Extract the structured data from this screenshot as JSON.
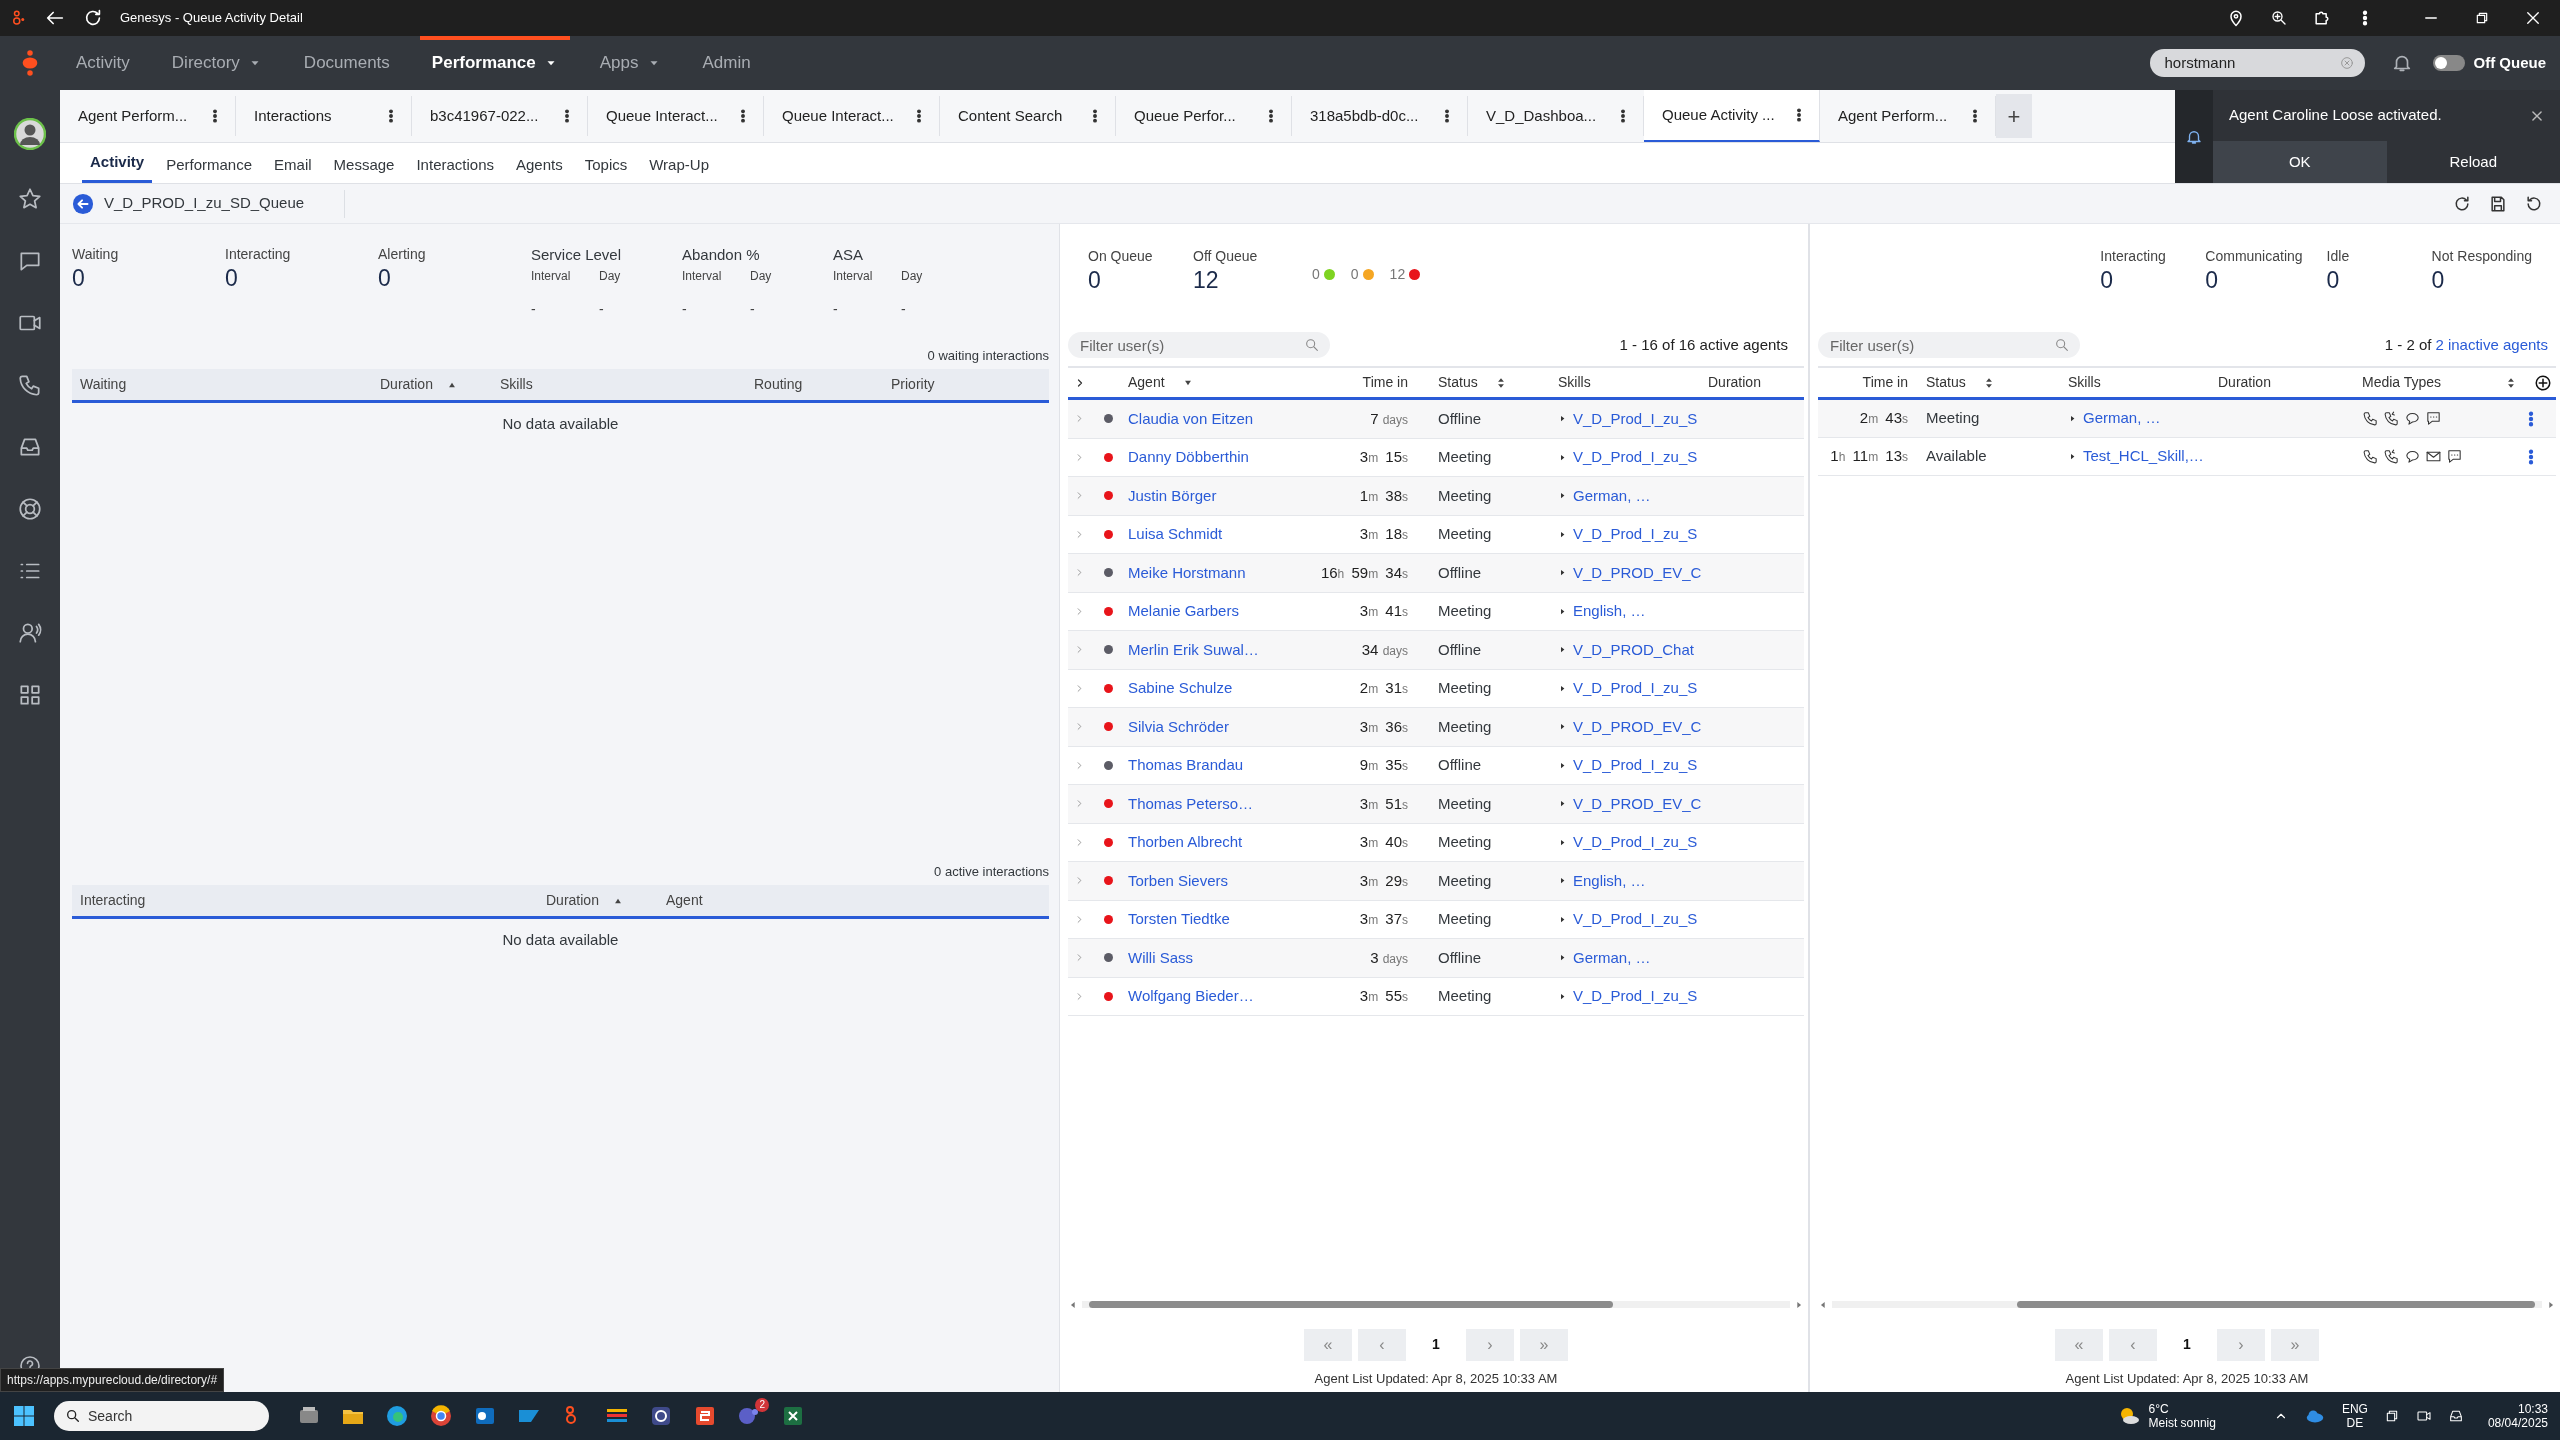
{
  "window": {
    "title": "Genesys - Queue Activity Detail"
  },
  "status_url": "https://apps.mypurecloud.de/directory/#",
  "nav": {
    "items": [
      {
        "label": "Activity",
        "dropdown": false,
        "selected": false
      },
      {
        "label": "Directory",
        "dropdown": true,
        "selected": false
      },
      {
        "label": "Documents",
        "dropdown": false,
        "selected": false
      },
      {
        "label": "Performance",
        "dropdown": true,
        "selected": true
      },
      {
        "label": "Apps",
        "dropdown": true,
        "selected": false
      },
      {
        "label": "Admin",
        "dropdown": false,
        "selected": false
      }
    ],
    "search": {
      "value": "horstmann"
    },
    "queue_toggle": {
      "label": "Off Queue",
      "on": false
    }
  },
  "tabs": [
    {
      "label": "Agent Perform...",
      "selected": false
    },
    {
      "label": "Interactions",
      "selected": false
    },
    {
      "label": "b3c41967-022...",
      "selected": false
    },
    {
      "label": "Queue Interact...",
      "selected": false
    },
    {
      "label": "Queue Interact...",
      "selected": false
    },
    {
      "label": "Content Search",
      "selected": false
    },
    {
      "label": "Queue Perfor...",
      "selected": false
    },
    {
      "label": "318a5bdb-d0c...",
      "selected": false
    },
    {
      "label": "V_D_Dashboa...",
      "selected": false
    },
    {
      "label": "Queue Activity ...",
      "selected": true
    },
    {
      "label": "Agent Perform...",
      "selected": false
    }
  ],
  "new_tab": "+",
  "notification": {
    "message": "Agent Caroline Loose activated.",
    "buttons": [
      "OK",
      "Reload"
    ]
  },
  "subtabs": [
    {
      "label": "Activity",
      "selected": true
    },
    {
      "label": "Performance",
      "selected": false
    },
    {
      "label": "Email",
      "selected": false
    },
    {
      "label": "Message",
      "selected": false
    },
    {
      "label": "Interactions",
      "selected": false
    },
    {
      "label": "Agents",
      "selected": false
    },
    {
      "label": "Topics",
      "selected": false
    },
    {
      "label": "Wrap-Up",
      "selected": false
    }
  ],
  "queue": {
    "name": "V_D_PROD_I_zu_SD_Queue"
  },
  "queue_stats": [
    {
      "label": "Waiting",
      "value": "0"
    },
    {
      "label": "Interacting",
      "value": "0"
    },
    {
      "label": "Alerting",
      "value": "0"
    }
  ],
  "queue_metrics": [
    {
      "label": "Service Level",
      "periods": [
        {
          "label": "Interval",
          "value": "-"
        },
        {
          "label": "Day",
          "value": "-"
        }
      ]
    },
    {
      "label": "Abandon %",
      "periods": [
        {
          "label": "Interval",
          "value": "-"
        },
        {
          "label": "Day",
          "value": "-"
        }
      ]
    },
    {
      "label": "ASA",
      "periods": [
        {
          "label": "Interval",
          "value": "-"
        },
        {
          "label": "Day",
          "value": "-"
        }
      ]
    }
  ],
  "waiting": {
    "count": "0 waiting interactions",
    "columns": [
      {
        "label": "Waiting",
        "kind": "plain"
      },
      {
        "label": "Duration",
        "kind": "sort_asc"
      },
      {
        "label": "Skills",
        "kind": "plain"
      },
      {
        "label": "Routing",
        "kind": "plain"
      },
      {
        "label": "Priority",
        "kind": "plain"
      }
    ],
    "empty": "No data available"
  },
  "interacting": {
    "count": "0 active interactions",
    "columns": [
      {
        "label": "Interacting",
        "kind": "plain"
      },
      {
        "label": "Duration",
        "kind": "sort_asc"
      },
      {
        "label": "Agent",
        "kind": "plain"
      }
    ],
    "empty": "No data available"
  },
  "active_agents": {
    "stats": [
      {
        "label": "On Queue",
        "value": "0"
      },
      {
        "label": "Off Queue",
        "value": "12"
      }
    ],
    "status_counts": [
      {
        "value": "0",
        "color": "#7ed321"
      },
      {
        "value": "0",
        "color": "#f5a623"
      },
      {
        "value": "12",
        "color": "#e8141a"
      }
    ],
    "filter": {
      "placeholder": "Filter user(s)"
    },
    "summary": "1 - 16 of 16 active agents",
    "columns": [
      {
        "label": "Agent",
        "kind": "sort_desc"
      },
      {
        "label": "Time in",
        "kind": "plain"
      },
      {
        "label": "Status",
        "kind": "sort_both"
      },
      {
        "label": "Skills",
        "kind": "plain"
      },
      {
        "label": "Duration",
        "kind": "plain"
      }
    ],
    "rows": [
      {
        "name": "Claudia von Eitzen",
        "color": "#5c5c66",
        "time_in": "7 days",
        "status": "Offline",
        "skills": "V_D_Prod_I_zu_S"
      },
      {
        "name": "Danny Döbberthin",
        "color": "#e8141a",
        "time_in": "3m 15s",
        "status": "Meeting",
        "skills": "V_D_Prod_I_zu_S"
      },
      {
        "name": "Justin Börger",
        "color": "#e8141a",
        "time_in": "1m 38s",
        "status": "Meeting",
        "skills": "German, …"
      },
      {
        "name": "Luisa Schmidt",
        "color": "#e8141a",
        "time_in": "3m 18s",
        "status": "Meeting",
        "skills": "V_D_Prod_I_zu_S"
      },
      {
        "name": "Meike Horstmann",
        "color": "#5c5c66",
        "time_in": "16h 59m 34s",
        "status": "Offline",
        "skills": "V_D_PROD_EV_C"
      },
      {
        "name": "Melanie Garbers",
        "color": "#e8141a",
        "time_in": "3m 41s",
        "status": "Meeting",
        "skills": "English, …"
      },
      {
        "name": "Merlin Erik Suwal…",
        "color": "#5c5c66",
        "time_in": "34 days",
        "status": "Offline",
        "skills": "V_D_PROD_Chat"
      },
      {
        "name": "Sabine Schulze",
        "color": "#e8141a",
        "time_in": "2m 31s",
        "status": "Meeting",
        "skills": "V_D_Prod_I_zu_S"
      },
      {
        "name": "Silvia Schröder",
        "color": "#e8141a",
        "time_in": "3m 36s",
        "status": "Meeting",
        "skills": "V_D_PROD_EV_C"
      },
      {
        "name": "Thomas Brandau",
        "color": "#5c5c66",
        "time_in": "9m 35s",
        "status": "Offline",
        "skills": "V_D_Prod_I_zu_S"
      },
      {
        "name": "Thomas Peterso…",
        "color": "#e8141a",
        "time_in": "3m 51s",
        "status": "Meeting",
        "skills": "V_D_PROD_EV_C"
      },
      {
        "name": "Thorben Albrecht",
        "color": "#e8141a",
        "time_in": "3m 40s",
        "status": "Meeting",
        "skills": "V_D_Prod_I_zu_S"
      },
      {
        "name": "Torben Sievers",
        "color": "#e8141a",
        "time_in": "3m 29s",
        "status": "Meeting",
        "skills": "English, …"
      },
      {
        "name": "Torsten Tiedtke",
        "color": "#e8141a",
        "time_in": "3m 37s",
        "status": "Meeting",
        "skills": "V_D_Prod_I_zu_S"
      },
      {
        "name": "Willi Sass",
        "color": "#5c5c66",
        "time_in": "3 days",
        "status": "Offline",
        "skills": "German, …"
      },
      {
        "name": "Wolfgang Bieder…",
        "color": "#e8141a",
        "time_in": "3m 55s",
        "status": "Meeting",
        "skills": "V_D_Prod_I_zu_S"
      }
    ],
    "pager": {
      "first": "«",
      "prev": "‹",
      "page": "1",
      "next": "›",
      "last": "»"
    },
    "updated": "Agent List Updated: Apr 8, 2025 10:33 AM"
  },
  "inactive_agents": {
    "stats": [
      {
        "label": "Interacting",
        "value": "0"
      },
      {
        "label": "Communicating",
        "value": "0"
      },
      {
        "label": "Idle",
        "value": "0"
      },
      {
        "label": "Not Responding",
        "value": "0"
      }
    ],
    "filter": {
      "placeholder": "Filter user(s)"
    },
    "summary": "1 - 2 of",
    "summary_link": "2 inactive agents",
    "columns": [
      {
        "label": "Time in",
        "kind": "plain"
      },
      {
        "label": "Status",
        "kind": "sort_both"
      },
      {
        "label": "Skills",
        "kind": "plain"
      },
      {
        "label": "Duration",
        "kind": "plain"
      },
      {
        "label": "Media Types",
        "kind": "sort_both"
      }
    ],
    "rows": [
      {
        "time_in": "2m 43s",
        "status": "Meeting",
        "skills": "German, …",
        "media": [
          {
            "kind": "phone"
          },
          {
            "kind": "callback"
          },
          {
            "kind": "chat"
          },
          {
            "kind": "message"
          }
        ]
      },
      {
        "time_in": "1h 11m 13s",
        "status": "Available",
        "skills": "Test_HCL_Skill,…",
        "media": [
          {
            "kind": "phone"
          },
          {
            "kind": "callback"
          },
          {
            "kind": "chat"
          },
          {
            "kind": "email"
          },
          {
            "kind": "message"
          }
        ]
      }
    ],
    "pager": {
      "first": "«",
      "prev": "‹",
      "page": "1",
      "next": "›",
      "last": "»"
    },
    "updated": "Agent List Updated: Apr 8, 2025 10:33 AM"
  },
  "taskbar": {
    "search": {
      "placeholder": "Search"
    },
    "badge": "2",
    "weather": {
      "temp": "6°C",
      "text": "Meist sonnig"
    },
    "language": [
      "ENG",
      "DE"
    ],
    "time": "10:33",
    "date": "08/04/2025"
  }
}
